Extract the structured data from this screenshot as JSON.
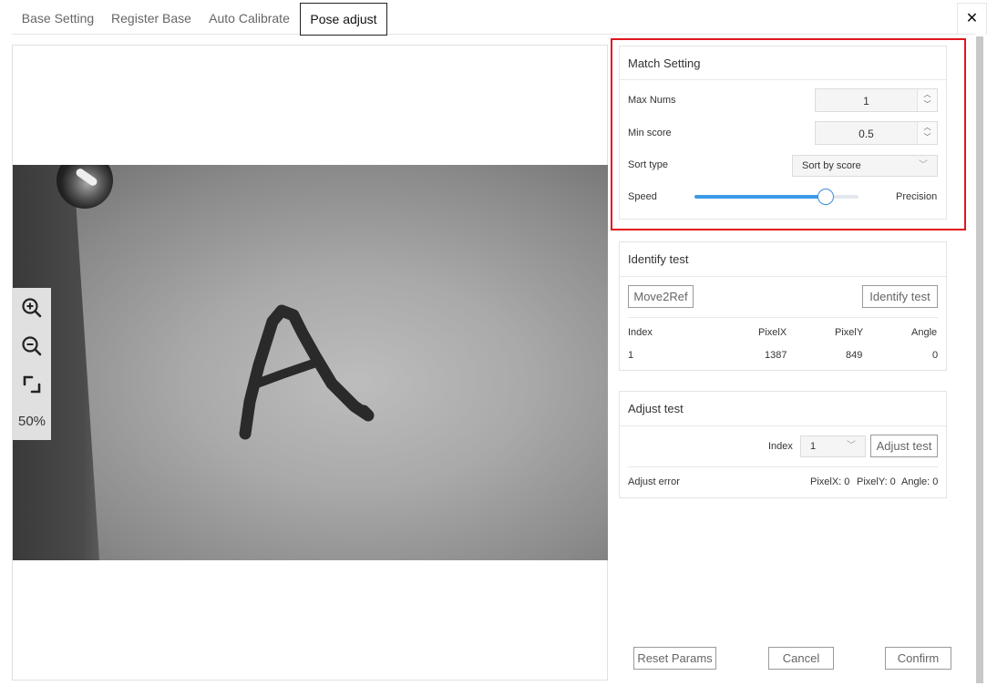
{
  "tabs": [
    {
      "label": "Base Setting",
      "active": false
    },
    {
      "label": "Register Base",
      "active": false
    },
    {
      "label": "Auto Calibrate",
      "active": false
    },
    {
      "label": "Pose adjust",
      "active": true
    }
  ],
  "close_label": "✕",
  "viewer": {
    "zoom_percent": "50%",
    "tools": [
      "zoom-in-icon",
      "zoom-out-icon",
      "fit-screen-icon"
    ]
  },
  "match_setting": {
    "title": "Match Setting",
    "max_nums_label": "Max Nums",
    "max_nums_value": "1",
    "min_score_label": "Min score",
    "min_score_value": "0.5",
    "sort_type_label": "Sort type",
    "sort_type_value": "Sort by score",
    "speed_label": "Speed",
    "precision_label": "Precision",
    "speed_precision_level": 0.8,
    "highlight_color": "#e0161f",
    "slider_color": "#3c9ae8"
  },
  "identify_test": {
    "title": "Identify test",
    "move_button": "Move2Ref",
    "identify_button": "Identify test",
    "columns": [
      "Index",
      "PixelX",
      "PixelY",
      "Angle"
    ],
    "rows": [
      {
        "index": "1",
        "pixel_x": "1387",
        "pixel_y": "849",
        "angle": "0"
      }
    ]
  },
  "adjust_test": {
    "title": "Adjust test",
    "index_label": "Index",
    "index_value": "1",
    "adjust_button": "Adjust test",
    "error_label": "Adjust error",
    "pixel_x_text": "PixelX: 0",
    "pixel_y_text": "PixelY: 0",
    "angle_text": "Angle: 0"
  },
  "footer": {
    "reset_button": "Reset Params",
    "cancel_button": "Cancel",
    "confirm_button": "Confirm"
  }
}
